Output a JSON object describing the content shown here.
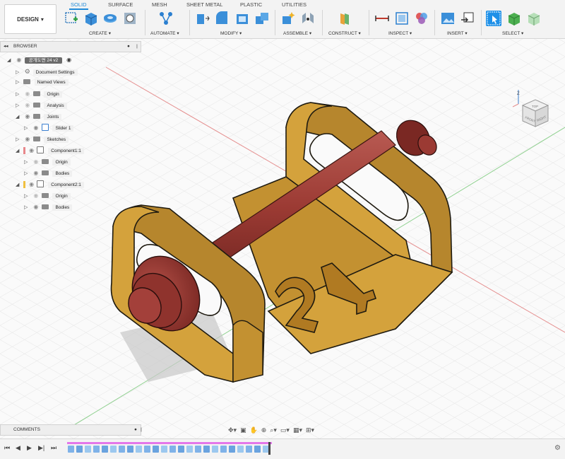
{
  "workspace": {
    "label": "DESIGN"
  },
  "tabs": [
    {
      "label": "SOLID",
      "active": true
    },
    {
      "label": "SURFACE"
    },
    {
      "label": "MESH"
    },
    {
      "label": "SHEET METAL"
    },
    {
      "label": "PLASTIC"
    },
    {
      "label": "UTILITIES"
    }
  ],
  "toolbar_groups": {
    "create": "CREATE",
    "automate": "AUTOMATE",
    "modify": "MODIFY",
    "assemble": "ASSEMBLE",
    "construct": "CONSTRUCT",
    "inspect": "INSPECT",
    "insert": "INSERT",
    "select": "SELECT"
  },
  "browser": {
    "title": "BROWSER",
    "root_label": "공개도면 24 v2",
    "items": [
      {
        "label": "Document Settings",
        "icon": "gear-icon"
      },
      {
        "label": "Named Views",
        "icon": "folder-icon"
      },
      {
        "label": "Origin",
        "icon": "folder-icon"
      },
      {
        "label": "Analysis",
        "icon": "folder-icon"
      },
      {
        "label": "Joints",
        "icon": "folder-icon"
      },
      {
        "label": "Slider 1",
        "icon": "slider-joint-icon"
      },
      {
        "label": "Sketches",
        "icon": "folder-icon"
      },
      {
        "label": "Component1:1",
        "icon": "component-icon",
        "color": "#e8878b"
      },
      {
        "label": "Origin",
        "icon": "folder-icon"
      },
      {
        "label": "Bodies",
        "icon": "folder-icon"
      },
      {
        "label": "Component2:1",
        "icon": "component-icon",
        "color": "#f0c040"
      },
      {
        "label": "Origin",
        "icon": "folder-icon"
      },
      {
        "label": "Bodies",
        "icon": "folder-icon"
      }
    ]
  },
  "comments": {
    "title": "COMMENTS"
  },
  "model": {
    "engraving": "24",
    "bracket_color": "#d4a23c",
    "shaft_color": "#a3403a"
  },
  "viewcube": {
    "top": "TOP",
    "front": "FRONT",
    "right": "RIGHT"
  }
}
